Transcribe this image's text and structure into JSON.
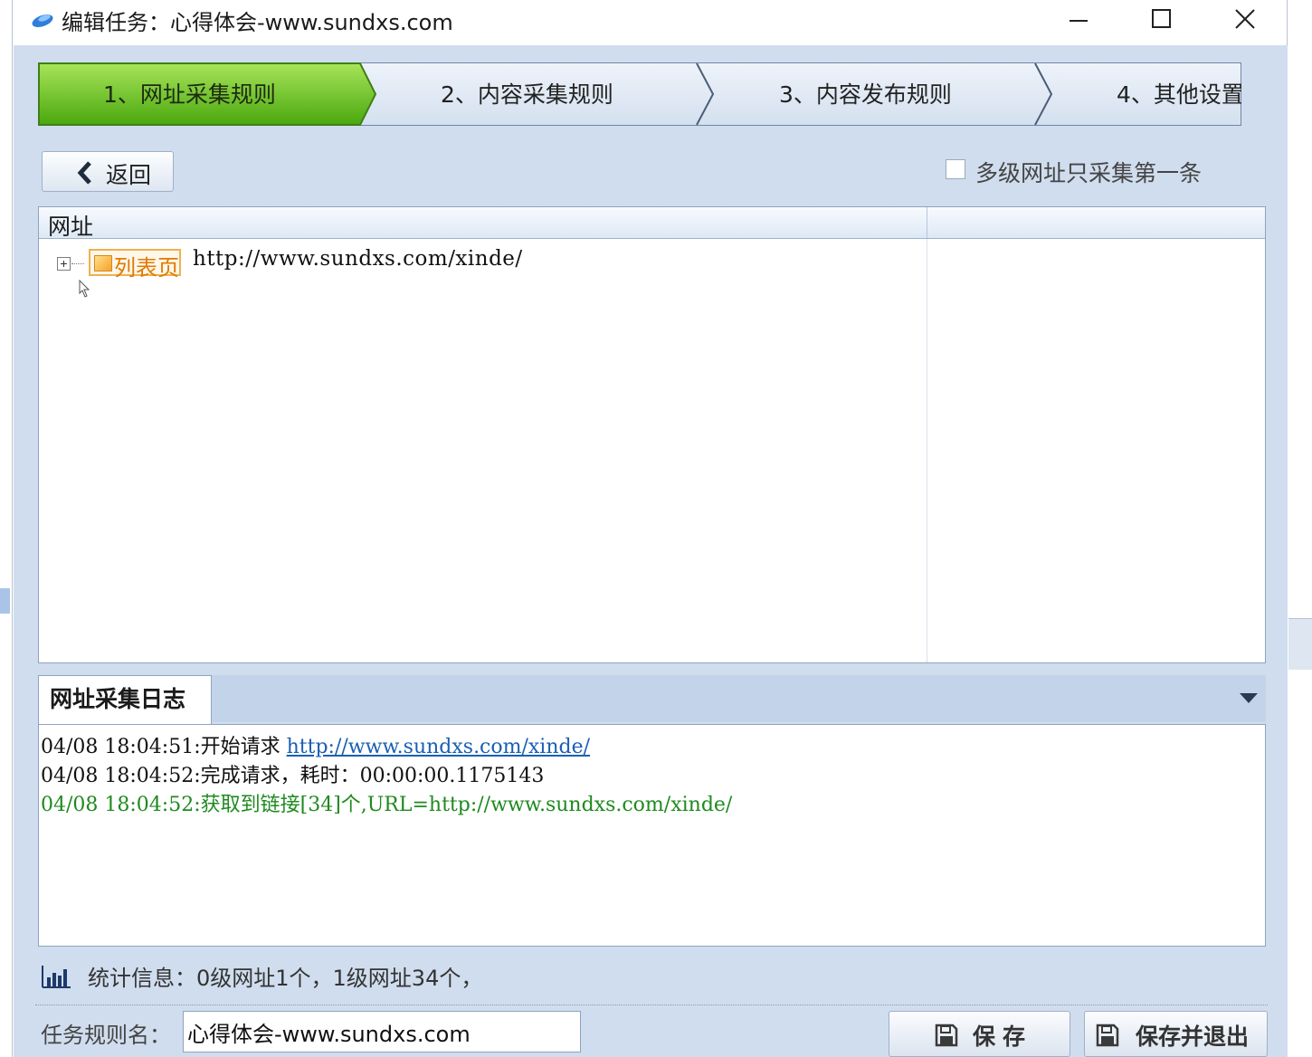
{
  "window": {
    "title": "编辑任务：心得体会-www.sundxs.com",
    "controls": [
      "minimize",
      "maximize",
      "close"
    ]
  },
  "steps": [
    {
      "label": "1、网址采集规则",
      "active": true
    },
    {
      "label": "2、内容采集规则",
      "active": false
    },
    {
      "label": "3、内容发布规则",
      "active": false
    },
    {
      "label": "4、其他设置",
      "active": false
    }
  ],
  "toolbar": {
    "back_label": "返回",
    "multi_level_checkbox": {
      "label": "多级网址只采集第一条",
      "checked": false
    }
  },
  "url_grid": {
    "columns": [
      "网址",
      ""
    ],
    "rows": [
      {
        "tag": "列表页",
        "url": "http://www.sundxs.com/xinde/",
        "expanded": false
      }
    ]
  },
  "log": {
    "tab_label": "网址采集日志",
    "lines": [
      {
        "prefix": "04/08 18:04:51:开始请求 ",
        "link": "http://www.sundxs.com/xinde/",
        "color": "#111111"
      },
      {
        "prefix": "04/08 18:04:52:完成请求，耗时：00:00:00.1175143",
        "link": "",
        "color": "#111111"
      },
      {
        "prefix": "04/08 18:04:52:获取到链接[34]个,URL=http://www.sundxs.com/xinde/",
        "link": "",
        "color": "#1f8a1f"
      }
    ]
  },
  "stats": {
    "text": "统计信息：0级网址1个，1级网址34个，"
  },
  "footer": {
    "rule_name_label": "任务规则名：",
    "rule_name_value": "心得体会-www.sundxs.com",
    "save_label": "保存",
    "save_exit_label": "保存并退出"
  },
  "colors": {
    "active_step": "#6cc417",
    "panel_bg": "#d0ddee",
    "tag_border": "#f0b050",
    "log_success": "#1f8a1f",
    "link": "#1a5fb4"
  }
}
